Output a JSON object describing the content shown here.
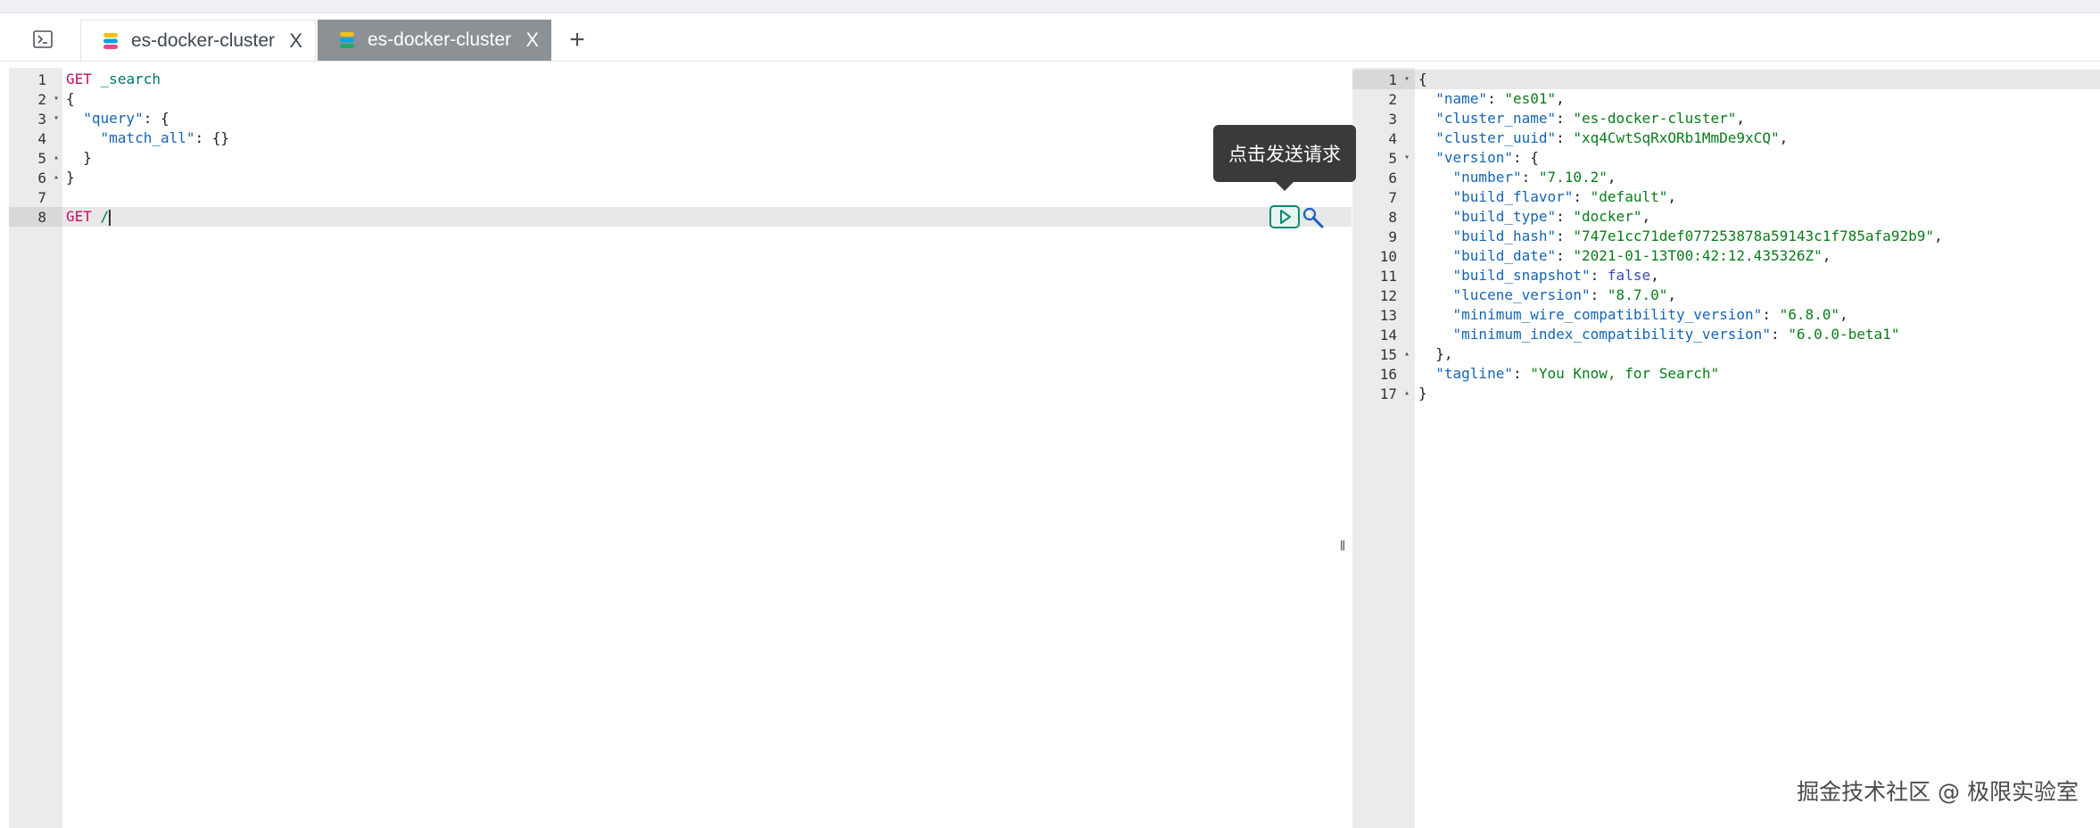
{
  "tabs": [
    {
      "label": "es-docker-cluster",
      "active": false
    },
    {
      "label": "es-docker-cluster",
      "active": true
    }
  ],
  "add_tab_label": "+",
  "tab_close_label": "X",
  "request_editor": {
    "lines": [
      {
        "num": "1",
        "fold": "",
        "parts": [
          {
            "t": "GET",
            "c": "m"
          },
          {
            "t": " ",
            "c": "n"
          },
          {
            "t": "_search",
            "c": "u"
          }
        ]
      },
      {
        "num": "2",
        "fold": "▾",
        "parts": [
          {
            "t": "{",
            "c": "n"
          }
        ]
      },
      {
        "num": "3",
        "fold": "▾",
        "parts": [
          {
            "t": "  ",
            "c": "n"
          },
          {
            "t": "\"query\"",
            "c": "k"
          },
          {
            "t": ": {",
            "c": "n"
          }
        ]
      },
      {
        "num": "4",
        "fold": "",
        "parts": [
          {
            "t": "    ",
            "c": "n"
          },
          {
            "t": "\"match_all\"",
            "c": "k"
          },
          {
            "t": ": {}",
            "c": "n"
          }
        ]
      },
      {
        "num": "5",
        "fold": "▴",
        "parts": [
          {
            "t": "  }",
            "c": "n"
          }
        ]
      },
      {
        "num": "6",
        "fold": "▴",
        "parts": [
          {
            "t": "}",
            "c": "n"
          }
        ]
      },
      {
        "num": "7",
        "fold": "",
        "parts": []
      },
      {
        "num": "8",
        "fold": "",
        "active": true,
        "cursor": true,
        "parts": [
          {
            "t": "GET",
            "c": "m"
          },
          {
            "t": " ",
            "c": "n"
          },
          {
            "t": "/",
            "c": "u"
          }
        ]
      }
    ]
  },
  "response_viewer": {
    "lines": [
      {
        "num": "1",
        "fold": "▾",
        "active": true,
        "parts": [
          {
            "t": "{",
            "c": "n"
          }
        ]
      },
      {
        "num": "2",
        "fold": "",
        "parts": [
          {
            "t": "  ",
            "c": "n"
          },
          {
            "t": "\"name\"",
            "c": "k"
          },
          {
            "t": ": ",
            "c": "n"
          },
          {
            "t": "\"es01\"",
            "c": "s"
          },
          {
            "t": ",",
            "c": "n"
          }
        ]
      },
      {
        "num": "3",
        "fold": "",
        "parts": [
          {
            "t": "  ",
            "c": "n"
          },
          {
            "t": "\"cluster_name\"",
            "c": "k"
          },
          {
            "t": ": ",
            "c": "n"
          },
          {
            "t": "\"es-docker-cluster\"",
            "c": "s"
          },
          {
            "t": ",",
            "c": "n"
          }
        ]
      },
      {
        "num": "4",
        "fold": "",
        "parts": [
          {
            "t": "  ",
            "c": "n"
          },
          {
            "t": "\"cluster_uuid\"",
            "c": "k"
          },
          {
            "t": ": ",
            "c": "n"
          },
          {
            "t": "\"xq4CwtSqRxORb1MmDe9xCQ\"",
            "c": "s"
          },
          {
            "t": ",",
            "c": "n"
          }
        ]
      },
      {
        "num": "5",
        "fold": "▾",
        "parts": [
          {
            "t": "  ",
            "c": "n"
          },
          {
            "t": "\"version\"",
            "c": "k"
          },
          {
            "t": ": {",
            "c": "n"
          }
        ]
      },
      {
        "num": "6",
        "fold": "",
        "parts": [
          {
            "t": "    ",
            "c": "n"
          },
          {
            "t": "\"number\"",
            "c": "k"
          },
          {
            "t": ": ",
            "c": "n"
          },
          {
            "t": "\"7.10.2\"",
            "c": "s"
          },
          {
            "t": ",",
            "c": "n"
          }
        ]
      },
      {
        "num": "7",
        "fold": "",
        "parts": [
          {
            "t": "    ",
            "c": "n"
          },
          {
            "t": "\"build_flavor\"",
            "c": "k"
          },
          {
            "t": ": ",
            "c": "n"
          },
          {
            "t": "\"default\"",
            "c": "s"
          },
          {
            "t": ",",
            "c": "n"
          }
        ]
      },
      {
        "num": "8",
        "fold": "",
        "parts": [
          {
            "t": "    ",
            "c": "n"
          },
          {
            "t": "\"build_type\"",
            "c": "k"
          },
          {
            "t": ": ",
            "c": "n"
          },
          {
            "t": "\"docker\"",
            "c": "s"
          },
          {
            "t": ",",
            "c": "n"
          }
        ]
      },
      {
        "num": "9",
        "fold": "",
        "parts": [
          {
            "t": "    ",
            "c": "n"
          },
          {
            "t": "\"build_hash\"",
            "c": "k"
          },
          {
            "t": ": ",
            "c": "n"
          },
          {
            "t": "\"747e1cc71def077253878a59143c1f785afa92b9\"",
            "c": "s"
          },
          {
            "t": ",",
            "c": "n"
          }
        ]
      },
      {
        "num": "10",
        "fold": "",
        "parts": [
          {
            "t": "    ",
            "c": "n"
          },
          {
            "t": "\"build_date\"",
            "c": "k"
          },
          {
            "t": ": ",
            "c": "n"
          },
          {
            "t": "\"2021-01-13T00:42:12.435326Z\"",
            "c": "s"
          },
          {
            "t": ",",
            "c": "n"
          }
        ]
      },
      {
        "num": "11",
        "fold": "",
        "parts": [
          {
            "t": "    ",
            "c": "n"
          },
          {
            "t": "\"build_snapshot\"",
            "c": "k"
          },
          {
            "t": ": ",
            "c": "n"
          },
          {
            "t": "false",
            "c": "b"
          },
          {
            "t": ",",
            "c": "n"
          }
        ]
      },
      {
        "num": "12",
        "fold": "",
        "parts": [
          {
            "t": "    ",
            "c": "n"
          },
          {
            "t": "\"lucene_version\"",
            "c": "k"
          },
          {
            "t": ": ",
            "c": "n"
          },
          {
            "t": "\"8.7.0\"",
            "c": "s"
          },
          {
            "t": ",",
            "c": "n"
          }
        ]
      },
      {
        "num": "13",
        "fold": "",
        "parts": [
          {
            "t": "    ",
            "c": "n"
          },
          {
            "t": "\"minimum_wire_compatibility_version\"",
            "c": "k"
          },
          {
            "t": ": ",
            "c": "n"
          },
          {
            "t": "\"6.8.0\"",
            "c": "s"
          },
          {
            "t": ",",
            "c": "n"
          }
        ]
      },
      {
        "num": "14",
        "fold": "",
        "parts": [
          {
            "t": "    ",
            "c": "n"
          },
          {
            "t": "\"minimum_index_compatibility_version\"",
            "c": "k"
          },
          {
            "t": ": ",
            "c": "n"
          },
          {
            "t": "\"6.0.0-beta1\"",
            "c": "s"
          }
        ]
      },
      {
        "num": "15",
        "fold": "▴",
        "parts": [
          {
            "t": "  },",
            "c": "n"
          }
        ]
      },
      {
        "num": "16",
        "fold": "",
        "parts": [
          {
            "t": "  ",
            "c": "n"
          },
          {
            "t": "\"tagline\"",
            "c": "k"
          },
          {
            "t": ": ",
            "c": "n"
          },
          {
            "t": "\"You Know, for Search\"",
            "c": "s"
          }
        ]
      },
      {
        "num": "17",
        "fold": "▴",
        "parts": [
          {
            "t": "}",
            "c": "n"
          }
        ]
      }
    ]
  },
  "tooltip_text": "点击发送请求",
  "icons": {
    "console": "console-icon",
    "send": "play-icon",
    "settings": "wrench-icon"
  },
  "resizer_glyph": "‖",
  "watermark": "掘金技术社区 @ 极限实验室",
  "colors": {
    "method": "#c80a68",
    "url": "#00756c",
    "key": "#1564b3",
    "string": "#0a7b1a",
    "boolean": "#3a49b2",
    "send_accent": "#0b8a73",
    "active_tab_bg": "#8c9195"
  }
}
